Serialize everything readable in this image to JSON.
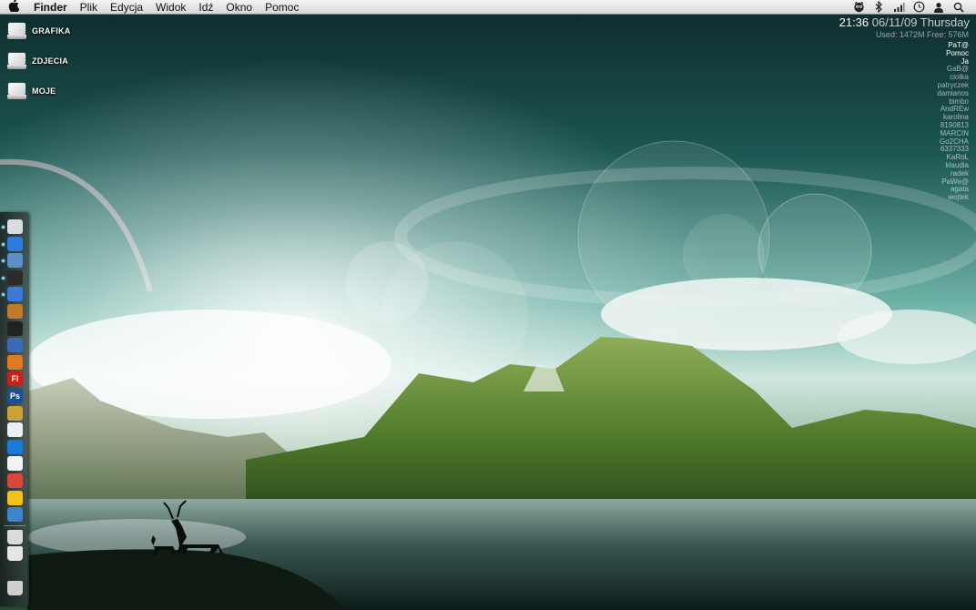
{
  "menubar": {
    "apple_icon": "apple-icon",
    "app_name": "Finder",
    "items": [
      "Plik",
      "Edycja",
      "Widok",
      "Idź",
      "Okno",
      "Pomoc"
    ],
    "extras": [
      "adium-icon",
      "bluetooth-icon",
      "wifi-icon",
      "clock-icon",
      "user-icon",
      "spotlight-icon"
    ]
  },
  "desktop": {
    "icons": [
      {
        "label": "GRAFIKA",
        "icon": "drive-icon"
      },
      {
        "label": "ZDJECIA",
        "icon": "drive-icon"
      },
      {
        "label": "MOJE",
        "icon": "drive-icon"
      }
    ]
  },
  "widget": {
    "time": "21:36",
    "date": "06/11/09 Thursday",
    "memory": "Used: 1472M Free: 576M"
  },
  "buddies": {
    "online": [
      "PaT@",
      "Pomoc",
      "Ja"
    ],
    "others": [
      "GaB@",
      "ciotka",
      "patryczek",
      "damianos",
      "bimbo",
      "AndREw",
      "karolina",
      "8190813",
      "MARCIN",
      "Go2CHA",
      "6337333",
      "KaRoL",
      "klaudia",
      "radek",
      "PaWe@",
      "agata",
      "wojtek"
    ]
  },
  "dock": {
    "items": [
      {
        "name": "finder-icon",
        "glyph": "",
        "color": "#d9dde2"
      },
      {
        "name": "safari-icon",
        "glyph": "",
        "color": "#2f7bd8"
      },
      {
        "name": "preview-icon",
        "glyph": "",
        "color": "#5d8fc9"
      },
      {
        "name": "adium-icon",
        "glyph": "",
        "color": "#2b2b2b"
      },
      {
        "name": "firefox-icon",
        "glyph": "",
        "color": "#3c78d8"
      },
      {
        "name": "garageband-icon",
        "glyph": "",
        "color": "#c27a2a"
      },
      {
        "name": "itunes-icon",
        "glyph": "",
        "color": "#222222"
      },
      {
        "name": "thunderbird-icon",
        "glyph": "",
        "color": "#3a6bb3"
      },
      {
        "name": "vlc-icon",
        "glyph": "",
        "color": "#e07a1e"
      },
      {
        "name": "flash-icon",
        "glyph": "Fl",
        "color": "#c8211b"
      },
      {
        "name": "photoshop-icon",
        "glyph": "Ps",
        "color": "#1d4f93"
      },
      {
        "name": "scripteditor-icon",
        "glyph": "",
        "color": "#caa23a"
      },
      {
        "name": "mail-icon",
        "glyph": "",
        "color": "#e8eef4"
      },
      {
        "name": "quicktime-icon",
        "glyph": "",
        "color": "#1b7ad6"
      },
      {
        "name": "textedit-icon",
        "glyph": "",
        "color": "#f2f2f2"
      },
      {
        "name": "chrome-icon",
        "glyph": "",
        "color": "#d8473b"
      },
      {
        "name": "cyberduck-icon",
        "glyph": "",
        "color": "#f2c21c"
      },
      {
        "name": "network-icon",
        "glyph": "",
        "color": "#3d86c9"
      },
      {
        "name": "applications-stack-icon",
        "glyph": "",
        "color": "#dcdcdc"
      },
      {
        "name": "downloads-stack-icon",
        "glyph": "",
        "color": "#e6e6e6"
      },
      {
        "name": "trash-icon",
        "glyph": "",
        "color": "#cfcfcf"
      }
    ]
  }
}
